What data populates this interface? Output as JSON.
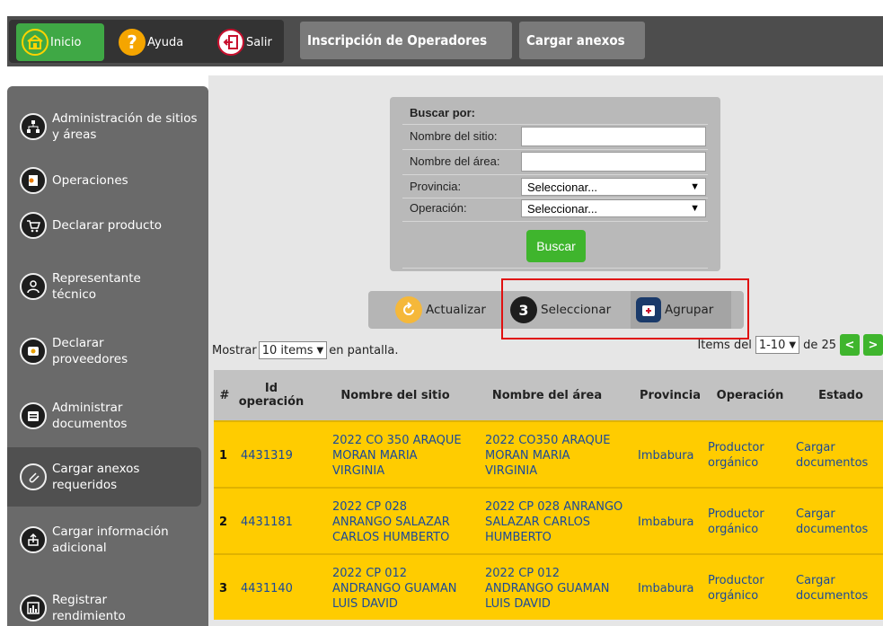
{
  "nav": {
    "inicio": "Inicio",
    "ayuda": "Ayuda",
    "salir": "Salir",
    "inscripcion": "Inscripción de Operadores",
    "cargar_anexos": "Cargar anexos"
  },
  "sidebar": {
    "items": [
      {
        "label": "Administración de sitios y áreas",
        "icon": "sitemap-icon"
      },
      {
        "label": "Operaciones",
        "icon": "operations-icon"
      },
      {
        "label": "Declarar producto",
        "icon": "cart-icon"
      },
      {
        "label": "Representante técnico",
        "icon": "user-tie-icon"
      },
      {
        "label": "Declarar proveedores",
        "icon": "supplier-icon"
      },
      {
        "label": "Administrar documentos",
        "icon": "folder-icon"
      },
      {
        "label": "Cargar anexos requeridos",
        "icon": "paperclip-icon"
      },
      {
        "label": "Cargar información adicional",
        "icon": "upload-icon"
      },
      {
        "label": "Registrar rendimiento",
        "icon": "chart-icon"
      }
    ]
  },
  "search": {
    "title": "Buscar por:",
    "site_label": "Nombre del sitio:",
    "area_label": "Nombre del área:",
    "provincia_label": "Provincia:",
    "provincia_value": "Seleccionar...",
    "operacion_label": "Operación:",
    "operacion_value": "Seleccionar...",
    "buscar": "Buscar"
  },
  "toolbar": {
    "actualizar": "Actualizar",
    "seleccionar": "Seleccionar",
    "agrupar": "Agrupar"
  },
  "listing": {
    "mostrar": "Mostrar",
    "items_value": "10 items",
    "en_pantalla": "en pantalla.",
    "items_del": "Items del",
    "range_value": "1-10",
    "de_total": "de 25",
    "prev": "<",
    "next": ">"
  },
  "table": {
    "headers": [
      "#",
      "Id operación",
      "Nombre del sitio",
      "Nombre del área",
      "Provincia",
      "Operación",
      "Estado"
    ],
    "rows": [
      {
        "n": "1",
        "id": "4431319",
        "sitio": "2022 CO 350 ARAQUE MORAN MARIA VIRGINIA",
        "area": "2022 CO350 ARAQUE MORAN MARIA VIRGINIA",
        "provincia": "Imbabura",
        "operacion": "Productor orgánico",
        "estado": "Cargar documentos"
      },
      {
        "n": "2",
        "id": "4431181",
        "sitio": "2022 CP 028 ANRANGO SALAZAR CARLOS HUMBERTO",
        "area": "2022 CP 028 ANRANGO SALAZAR CARLOS HUMBERTO",
        "provincia": "Imbabura",
        "operacion": "Productor orgánico",
        "estado": "Cargar documentos"
      },
      {
        "n": "3",
        "id": "4431140",
        "sitio": "2022 CP 012 ANDRANGO GUAMAN LUIS DAVID",
        "area": "2022 CP 012 ANDRANGO GUAMAN LUIS DAVID",
        "provincia": "Imbabura",
        "operacion": "Productor orgánico",
        "estado": "Cargar documentos"
      }
    ]
  },
  "colors": {
    "row_bg": "#ffcc00",
    "accent_green": "#3fb52d",
    "highlight_red": "#e01010"
  }
}
